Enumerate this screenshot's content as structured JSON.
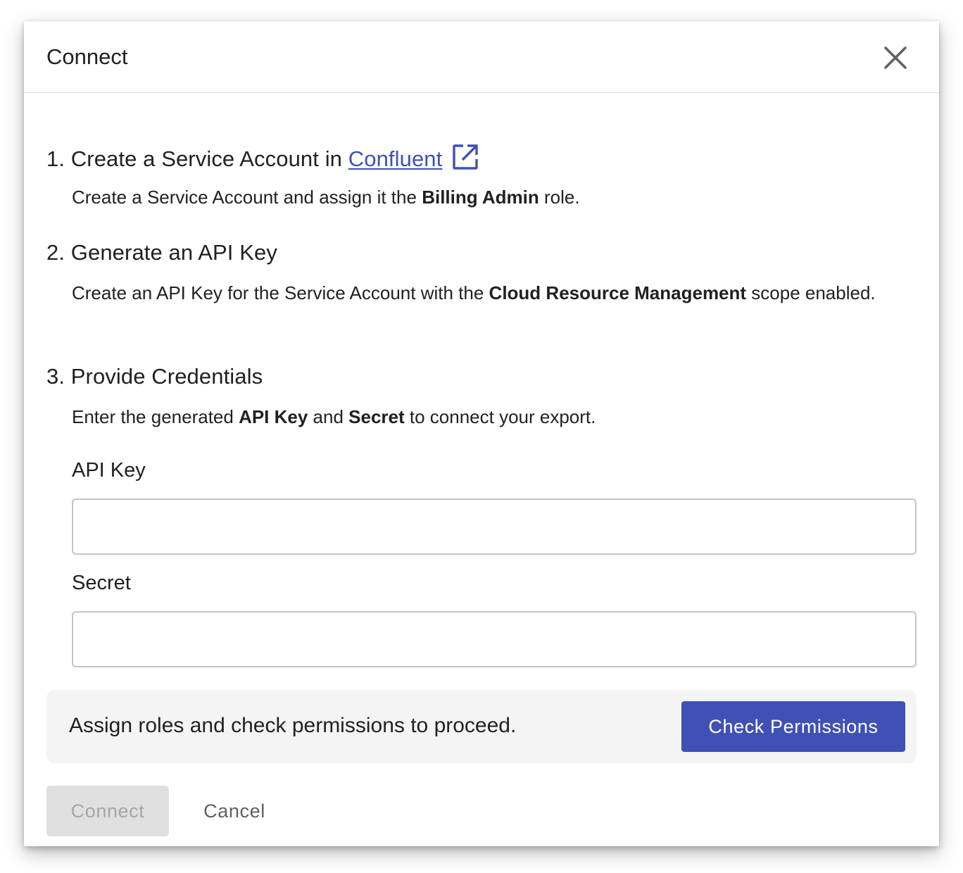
{
  "dialog": {
    "title": "Connect",
    "close_icon": "close-icon"
  },
  "steps": [
    {
      "number": "1.",
      "title_prefix": "Create a Service Account in",
      "link_text": "Confluent",
      "link_icon": "external-link-icon",
      "desc_before": "Create a Service Account and assign it the ",
      "desc_bold": "Billing Admin",
      "desc_after": " role."
    },
    {
      "number": "2.",
      "title": "Generate an API Key",
      "desc_before": "Create an API Key for the Service Account with the ",
      "desc_bold": "Cloud Resource Management",
      "desc_after": " scope enabled."
    },
    {
      "number": "3.",
      "title": "Provide Credentials",
      "desc_before": "Enter the generated ",
      "desc_bold1": "API Key",
      "desc_mid": " and ",
      "desc_bold2": "Secret",
      "desc_after": " to connect your export."
    }
  ],
  "fields": {
    "api_key": {
      "label": "API Key",
      "value": "",
      "placeholder": ""
    },
    "secret": {
      "label": "Secret",
      "value": "",
      "placeholder": ""
    }
  },
  "banner": {
    "text": "Assign roles and check permissions to proceed.",
    "button_label": "Check Permissions"
  },
  "footer": {
    "connect_label": "Connect",
    "cancel_label": "Cancel"
  },
  "colors": {
    "accent": "#3f51b5",
    "disabled_bg": "#e0e0e0",
    "disabled_text": "#a6a6a6",
    "banner_bg": "#f4f4f5"
  }
}
